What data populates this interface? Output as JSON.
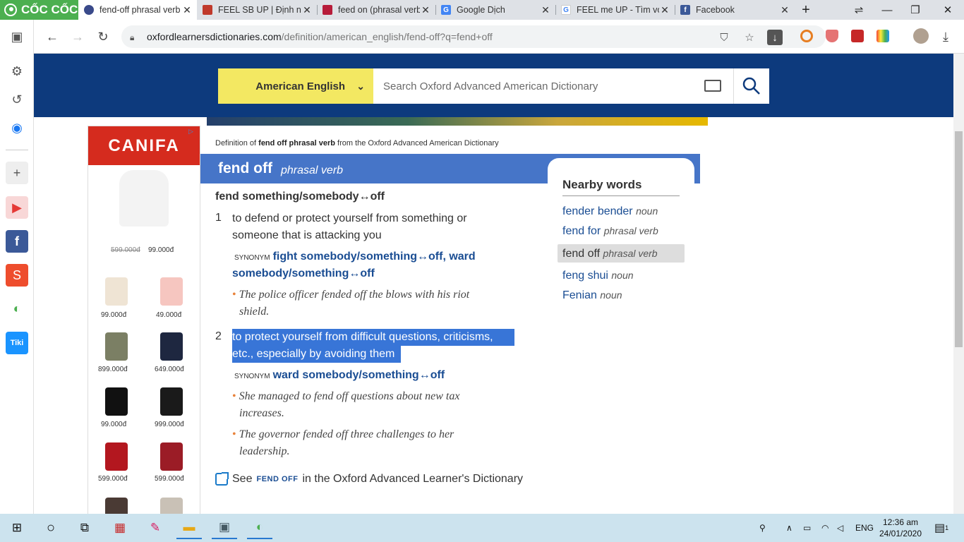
{
  "browser": {
    "logo_text": "CỐC CỐC",
    "tabs": [
      {
        "label": "fend-off phrasal verb",
        "active": true,
        "fav_color": "#3a4a8a"
      },
      {
        "label": "FEEL SB UP | Định ng",
        "active": false,
        "fav_color": "#c0392b"
      },
      {
        "label": "feed on (phrasal verb",
        "active": false,
        "fav_color": "#b71c3a"
      },
      {
        "label": "Google Dịch",
        "active": false,
        "fav_color": "#4285f4"
      },
      {
        "label": "FEEL me UP - Tìm với",
        "active": false,
        "fav_color": "#4285f4"
      },
      {
        "label": "Facebook",
        "active": false,
        "fav_color": "#3b5998"
      }
    ],
    "new_tab": "+",
    "url_host": "oxfordlearnersdictionaries.com",
    "url_path": "/definition/american_english/fend-off?q=fend+off"
  },
  "site": {
    "language": "American English",
    "search_placeholder": "Search Oxford Advanced American Dictionary"
  },
  "ad": {
    "brand": "CANIFA",
    "hero_old_price": "599.000đ",
    "hero_price": "99.000đ",
    "products": [
      {
        "price": "99.000đ",
        "color": "#efe4d4"
      },
      {
        "price": "49.000đ",
        "color": "#f6c6c0"
      },
      {
        "price": "899.000đ",
        "color": "#7b7f64"
      },
      {
        "price": "649.000đ",
        "color": "#1e2740"
      },
      {
        "price": "99.000đ",
        "color": "#111111"
      },
      {
        "price": "999.000đ",
        "color": "#1a1a1a"
      },
      {
        "price": "599.000đ",
        "color": "#b3171f"
      },
      {
        "price": "599.000đ",
        "color": "#9b1c26"
      },
      {
        "price": "",
        "color": "#4a3a34"
      },
      {
        "price": "",
        "color": "#c9c1b6"
      }
    ]
  },
  "entry": {
    "breadcrumb_prefix": "Definition of ",
    "breadcrumb_word": "fend off phrasal verb",
    "breadcrumb_suffix": " from the Oxford Advanced American Dictionary",
    "headword": "fend off",
    "pos": "phrasal verb",
    "frame": "fend something/somebody↔off",
    "senses": [
      {
        "num": "1",
        "def_lines": [
          "to defend or protect yourself from something or",
          "someone that is attacking you"
        ],
        "syn_label": "SYNONYM",
        "syn_line1": "fight somebody/something↔off, ward",
        "syn_line2": "somebody/something↔off",
        "examples": [
          {
            "line1": "The police officer fended off the blows with his riot",
            "line2": "shield."
          }
        ]
      },
      {
        "num": "2",
        "def_lines": [
          "to protect yourself from difficult questions, criticisms,",
          "etc., especially by avoiding them"
        ],
        "syn_label": "SYNONYM",
        "syn_line1": "ward somebody/something↔off",
        "examples": [
          {
            "line1": "She managed to fend off questions about new tax",
            "line2": "increases."
          },
          {
            "line1": "The governor fended off three challenges to her",
            "line2": "leadership."
          }
        ]
      }
    ],
    "see_prefix": "See",
    "see_word": "FEND OFF",
    "see_suffix": "in the Oxford Advanced Learner's Dictionary"
  },
  "nearby": {
    "title": "Nearby words",
    "items": [
      {
        "word": "fender bender",
        "pos": "noun",
        "current": false
      },
      {
        "word": "fend for",
        "pos": "phrasal verb",
        "current": false
      },
      {
        "word": "fend off",
        "pos": "phrasal verb",
        "current": true
      },
      {
        "word": "feng shui",
        "pos": "noun",
        "current": false
      },
      {
        "word": "Fenian",
        "pos": "noun",
        "current": false
      }
    ]
  },
  "taskbar": {
    "lang": "ENG",
    "time": "12:36 am",
    "date": "24/01/2020",
    "notif_count": "1"
  }
}
